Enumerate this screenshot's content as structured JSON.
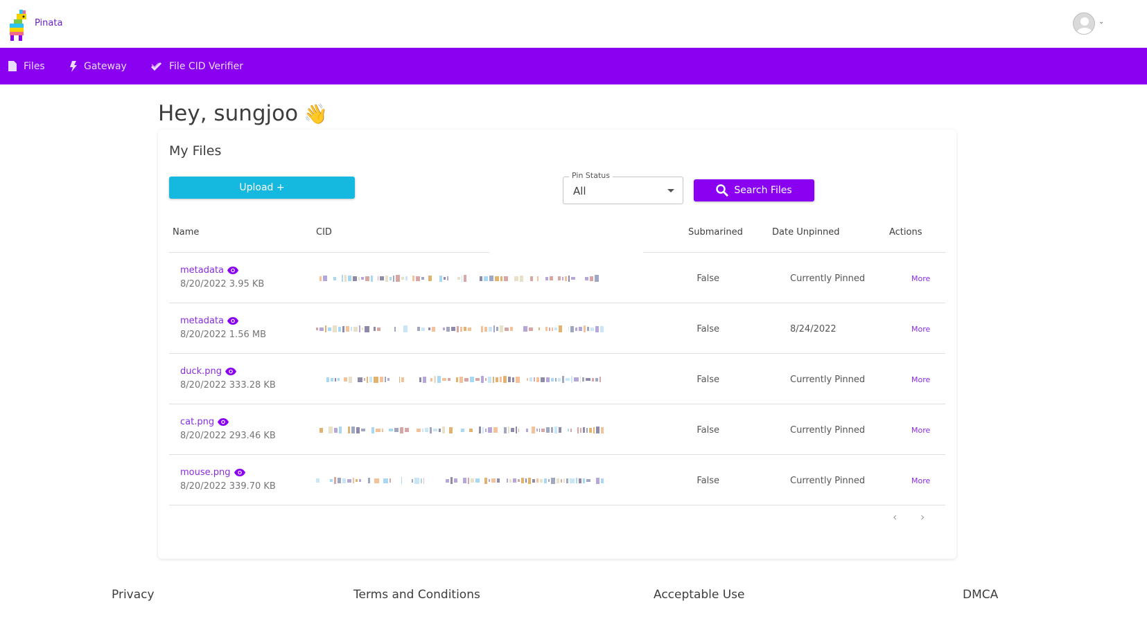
{
  "header": {
    "brand": "Pinata",
    "avatar_icon": "user-avatar-icon",
    "caret": "⌄"
  },
  "nav": {
    "items": [
      {
        "label": "Files",
        "icon": "file-icon"
      },
      {
        "label": "Gateway",
        "icon": "bolt-icon"
      },
      {
        "label": "File CID Verifier",
        "icon": "check-icon"
      }
    ]
  },
  "greeting": {
    "text": "Hey, sungjoo",
    "emoji": "👋"
  },
  "files_card": {
    "title": "My Files",
    "upload_label": "Upload +",
    "pin_status": {
      "label": "Pin Status",
      "value": "All"
    },
    "search_label": "Search Files",
    "columns": [
      "Name",
      "CID",
      "Submarined",
      "Date Unpinned",
      "Actions"
    ],
    "rows": [
      {
        "name": "metadata",
        "meta": "8/20/2022 3.95 KB",
        "submarined": "False",
        "date_unpinned": "Currently Pinned",
        "action": "More"
      },
      {
        "name": "metadata",
        "meta": "8/20/2022 1.56 MB",
        "submarined": "False",
        "date_unpinned": "8/24/2022",
        "action": "More"
      },
      {
        "name": "duck.png",
        "meta": "8/20/2022 333.28 KB",
        "submarined": "False",
        "date_unpinned": "Currently Pinned",
        "action": "More"
      },
      {
        "name": "cat.png",
        "meta": "8/20/2022 293.46 KB",
        "submarined": "False",
        "date_unpinned": "Currently Pinned",
        "action": "More"
      },
      {
        "name": "mouse.png",
        "meta": "8/20/2022 339.70 KB",
        "submarined": "False",
        "date_unpinned": "Currently Pinned",
        "action": "More"
      }
    ],
    "pager": {
      "prev": "‹",
      "next": "›"
    }
  },
  "footer": {
    "links": [
      "Privacy",
      "Terms and Conditions",
      "Acceptable Use",
      "DMCA"
    ]
  },
  "colors": {
    "brand_purple": "#8a00f0",
    "link_purple": "#8a2be2",
    "upload_cyan": "#15b8de"
  }
}
